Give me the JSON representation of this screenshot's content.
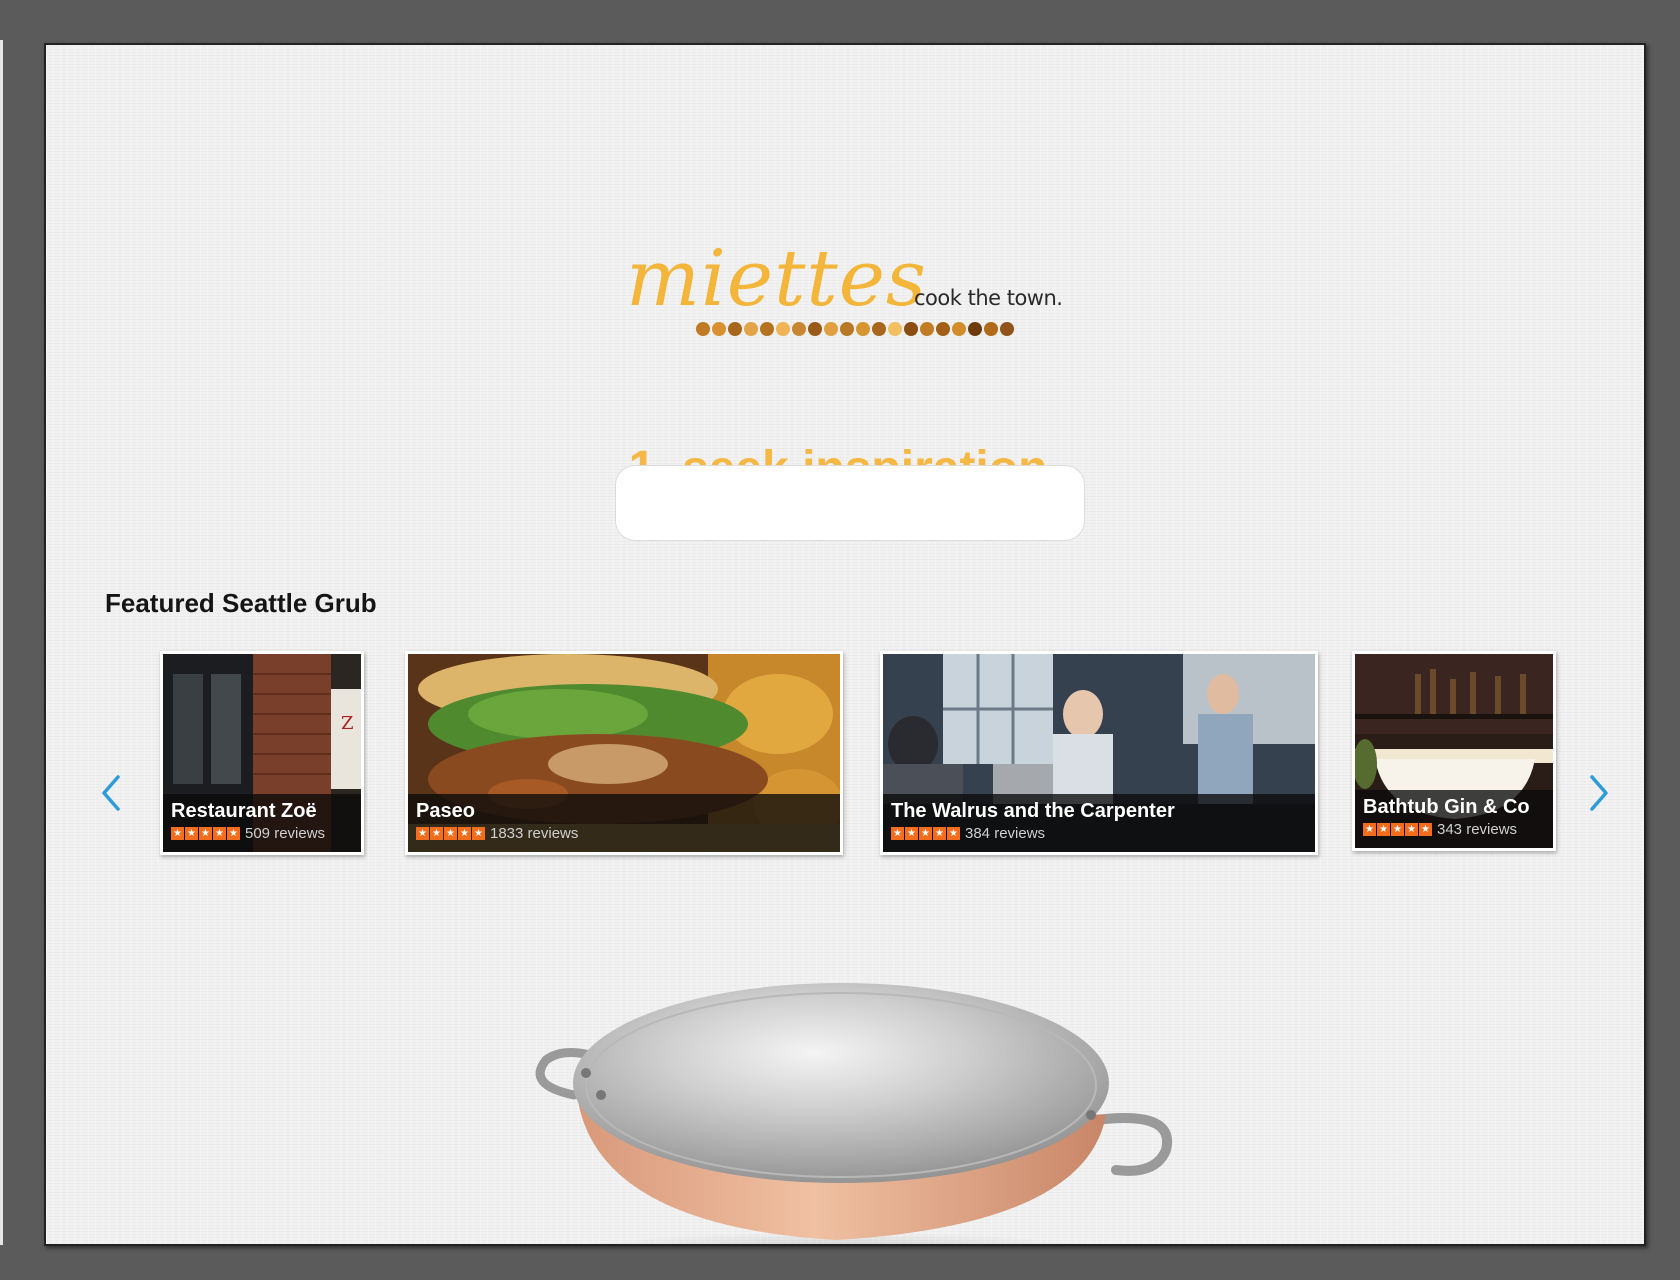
{
  "brand": {
    "logo_text": "miettes",
    "tagline": "cook the town.",
    "accent_color": "#f6b845",
    "dot_colors": [
      "#c07a22",
      "#d89030",
      "#a8651c",
      "#e3a447",
      "#b5731f",
      "#f0b455",
      "#c98632",
      "#9a5a18",
      "#e0a040",
      "#b97826",
      "#d6952f",
      "#a9661d",
      "#f2c062",
      "#8a4e12",
      "#c47c24",
      "#a35f18",
      "#d28d2a",
      "#6e3c0c",
      "#b06a1a",
      "#91531a"
    ]
  },
  "hero": {
    "heading": "1. seek inspiration",
    "search_placeholder": "",
    "search_value": ""
  },
  "featured": {
    "title": "Featured Seattle Grub",
    "prev_icon": "chevron-left-icon",
    "next_icon": "chevron-right-icon",
    "arrow_color": "#2f9bd8",
    "cards": [
      {
        "name": "Restaurant Zoë",
        "rating": 4.5,
        "reviews": "509 reviews"
      },
      {
        "name": "Paseo",
        "rating": 4.5,
        "reviews": "1833 reviews"
      },
      {
        "name": "The Walrus and the Carpenter",
        "rating": 4.5,
        "reviews": "384 reviews"
      },
      {
        "name": "Bathtub Gin & Co",
        "rating": 4.5,
        "reviews": "343 reviews"
      }
    ],
    "star_color": "#f36d1c"
  }
}
